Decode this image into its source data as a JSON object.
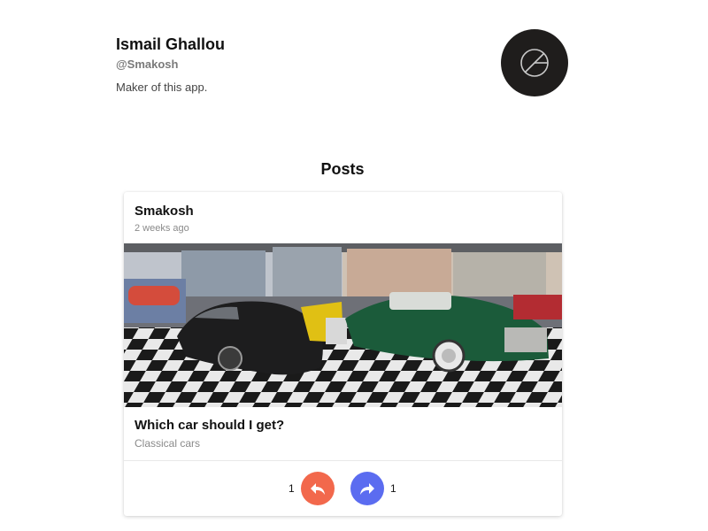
{
  "profile": {
    "name": "Ismail Ghallou",
    "handle": "@Smakosh",
    "bio": "Maker of this app.",
    "avatar_icon": "logo-icon"
  },
  "posts": {
    "heading": "Posts",
    "items": [
      {
        "author": "Smakosh",
        "time": "2 weeks ago",
        "image_description_icon": "car-photo",
        "title": "Which car should I get?",
        "subtitle": "Classical cars",
        "reply_count": "1",
        "share_count": "1"
      }
    ]
  },
  "colors": {
    "reply": "#f2684c",
    "share": "#5b6cf0",
    "avatar_bg": "#1f1d1c"
  }
}
